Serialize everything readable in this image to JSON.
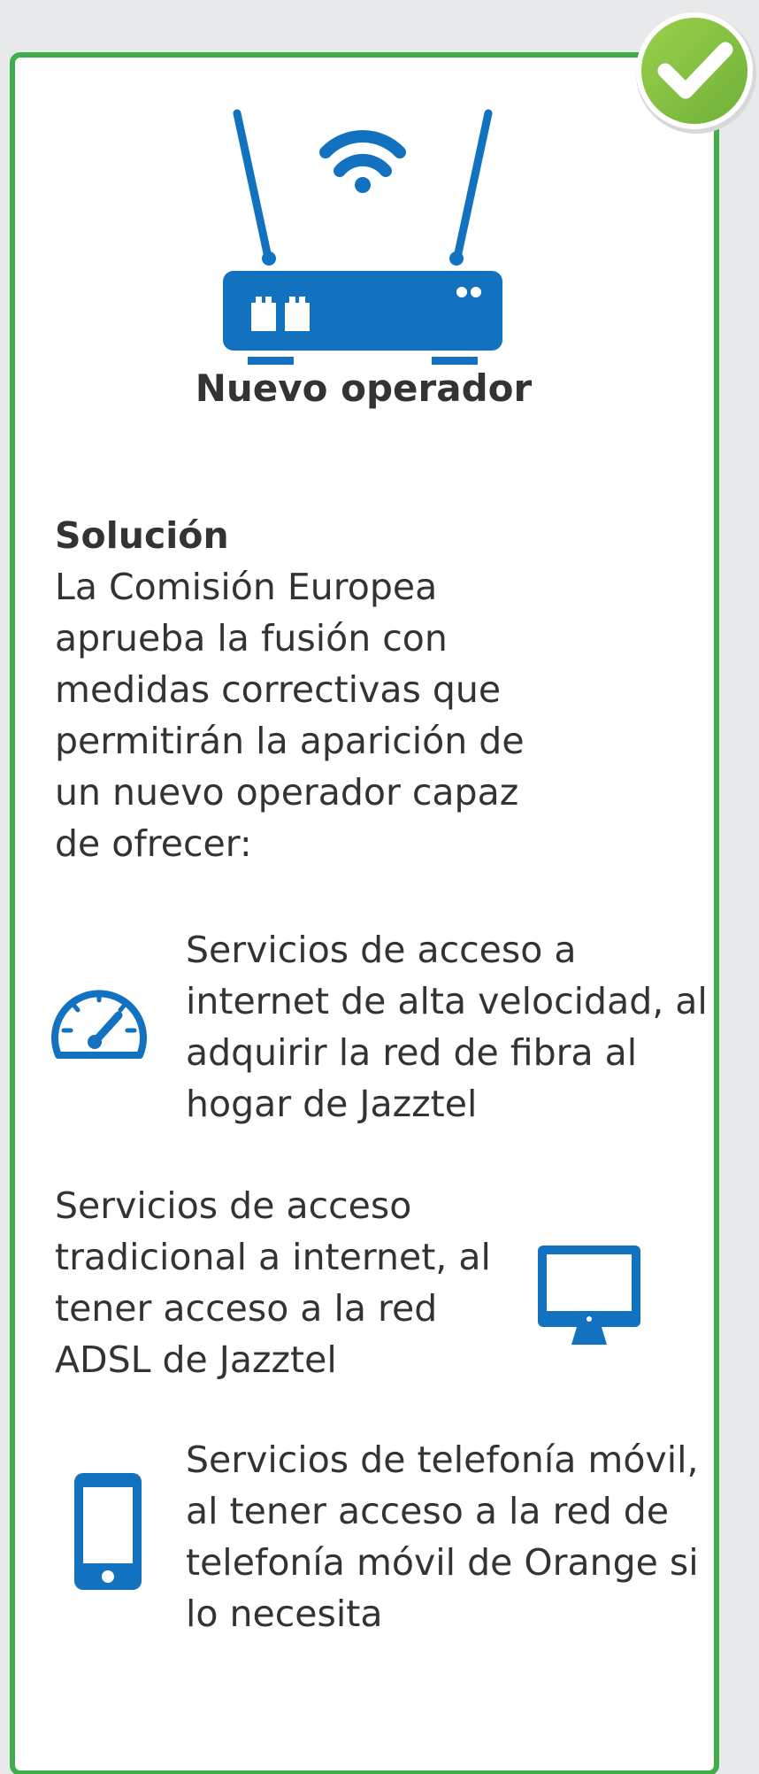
{
  "operator": {
    "label": "Nuevo operador",
    "icon": "router-icon"
  },
  "badge": {
    "icon": "check-icon",
    "color": "#8cc63f"
  },
  "solution": {
    "heading": "Solución",
    "body": "La Comisión Europea\naprueba la fusión con\nmedidas correctivas que\npermitirán la aparición de\nun nuevo operador capaz\nde ofrecer:"
  },
  "features": [
    {
      "icon": "speedometer-icon",
      "text": "Servicios de acceso a\ninternet de alta velocidad, al\nadquirir la red de fibra al\nhogar de Jazztel"
    },
    {
      "icon": "monitor-icon",
      "text": "Servicios de acceso\ntradicional a internet, al\ntener acceso a la red\nADSL de Jazztel"
    },
    {
      "icon": "smartphone-icon",
      "text": "Servicios de telefonía móvil,\nal tener acceso a la red de\ntelefonía móvil de Orange si\nlo necesita"
    }
  ],
  "colors": {
    "border": "#3fae49",
    "icon_blue": "#1272bf",
    "text": "#333333"
  }
}
